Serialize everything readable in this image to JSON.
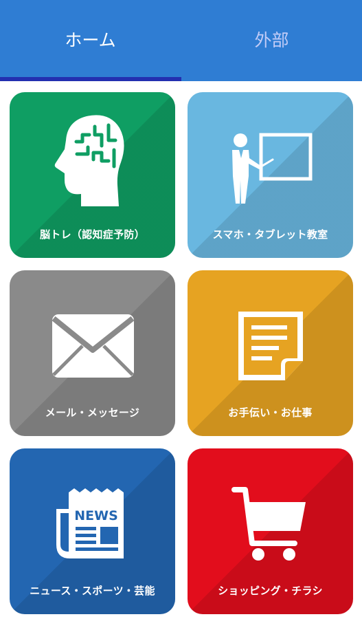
{
  "tabs": {
    "home": "ホーム",
    "external": "外部",
    "active": "home"
  },
  "colors": {
    "tab_bar": "#2f7dd3",
    "tab_indicator": "#232fb0",
    "brain_tile": "#0f9e63",
    "smartphone_tile": "#69b7e0",
    "mail_tile": "#8a8a8a",
    "work_tile": "#e6a322",
    "news_tile": "#2366b1",
    "shopping_tile": "#e20d1c"
  },
  "tiles": [
    {
      "label": "脳トレ（認知症予防）",
      "icon": "brain-head-icon"
    },
    {
      "label": "スマホ・タブレット教室",
      "icon": "teacher-board-icon"
    },
    {
      "label": "メール・メッセージ",
      "icon": "envelope-icon"
    },
    {
      "label": "お手伝い・お仕事",
      "icon": "document-icon"
    },
    {
      "label": "ニュース・スポーツ・芸能",
      "icon": "newspaper-icon",
      "icon_text": "NEWS"
    },
    {
      "label": "ショッピング・チラシ",
      "icon": "shopping-cart-icon"
    }
  ]
}
